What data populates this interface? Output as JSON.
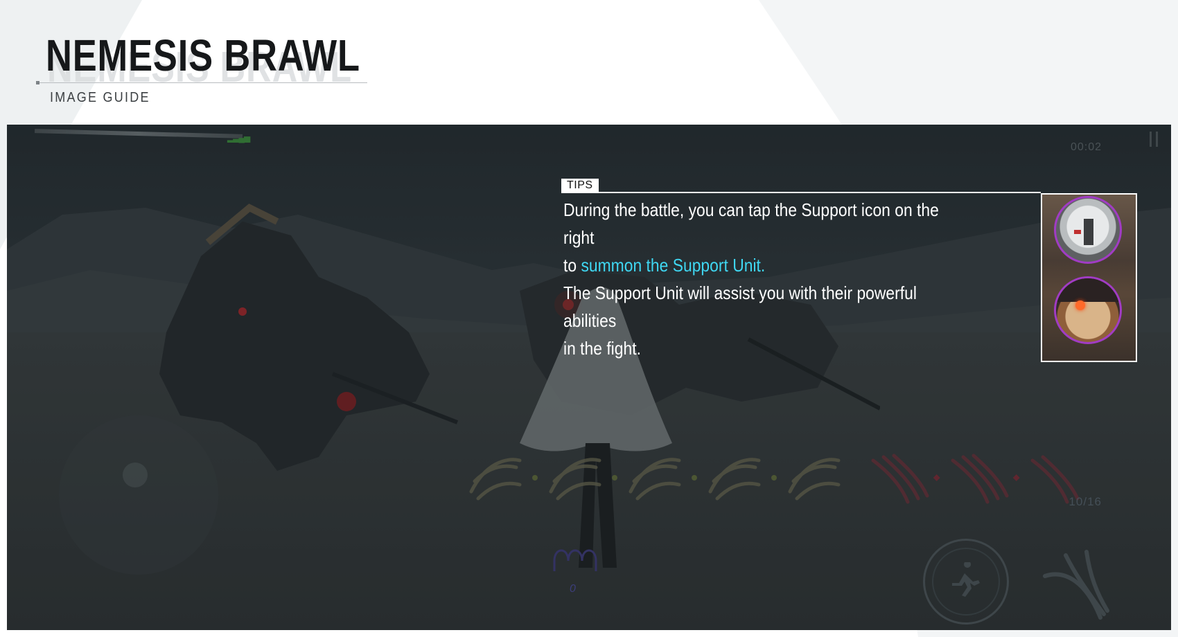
{
  "header": {
    "title": "NEMESIS BRAWL",
    "subtitle": "IMAGE GUIDE"
  },
  "game": {
    "timer": "00:02",
    "counter": "10/16",
    "skill_count": "0",
    "tips": {
      "label": "TIPS",
      "line1_prefix": "During the battle, you can tap the Support icon on the right",
      "line2_prefix": "to ",
      "line2_highlight": "summon the Support Unit.",
      "line3": "The Support Unit will assist you with their powerful abilities",
      "line4": "in the fight."
    },
    "support_icons": [
      "support-unit-robot-icon",
      "support-unit-mech-icon"
    ]
  },
  "colors": {
    "highlight": "#3fd7f2",
    "support_ring": "#a13cc4",
    "page_background": "#ffffff",
    "scene_background": "#2b3236"
  }
}
